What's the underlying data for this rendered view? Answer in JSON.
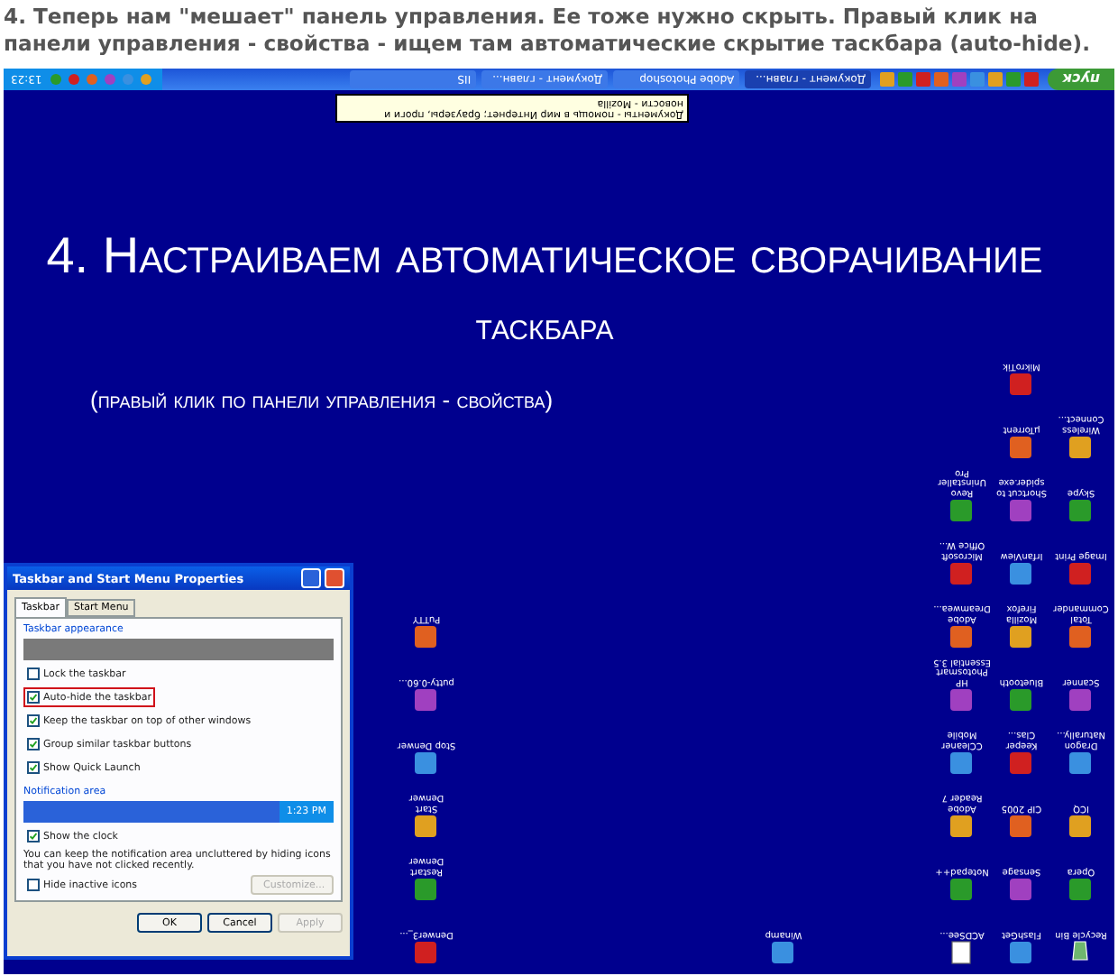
{
  "post_text": "4. Теперь нам \"мешает\" панель управления. Ее тоже нужно скрыть. Правый клик на панели управления - свойства - ищем там автоматические скрытие таскбара (auto-hide).",
  "screenshot": {
    "slide_title": [
      "4. Настраиваем автоматическое сворачивание",
      "таскбара"
    ],
    "slide_subtitle": "(правый клик по панели управления - свойства)",
    "taskbar": {
      "start": "пуск",
      "tasks": [
        {
          "label": "Документ - главн...",
          "selected": true
        },
        {
          "label": "Adobe Photoshop",
          "selected": false
        },
        {
          "label": "Документ - главн...",
          "selected": false
        },
        {
          "label": "IIS",
          "selected": false
        }
      ],
      "clock": "13:23"
    },
    "tooltip": "Документы - помощь в мир Интернет; браузеры, проги и новости - Mozilla",
    "desktop_columns": [
      {
        "icons": [
          {
            "label": "Recycle Bin",
            "kind": "bin"
          },
          {
            "label": "Opera",
            "kind": "app"
          },
          {
            "label": "ICQ",
            "kind": "app"
          },
          {
            "label": "Dragon Naturally...",
            "kind": "app"
          },
          {
            "label": "Scanner",
            "kind": "app"
          },
          {
            "label": "Total Commander",
            "kind": "app"
          },
          {
            "label": "Image Print",
            "kind": "app"
          },
          {
            "label": "Skype",
            "kind": "app"
          },
          {
            "label": "Wireless Connect...",
            "kind": "app"
          }
        ]
      },
      {
        "icons": [
          {
            "label": "FlashGet",
            "kind": "app"
          },
          {
            "label": "Sensage",
            "kind": "app"
          },
          {
            "label": "CIP 2005",
            "kind": "app"
          },
          {
            "label": "Keeper Clas...",
            "kind": "app"
          },
          {
            "label": "Bluetooth",
            "kind": "app"
          },
          {
            "label": "Mozilla Firefox",
            "kind": "app"
          },
          {
            "label": "IrfanView",
            "kind": "app"
          },
          {
            "label": "Shortcut to spider.exe",
            "kind": "app"
          },
          {
            "label": "µTorrent",
            "kind": "app"
          },
          {
            "label": "MikroTik",
            "kind": "app"
          }
        ]
      },
      {
        "icons": [
          {
            "label": "ACDSee...",
            "kind": "doc"
          },
          {
            "label": "Notepad++",
            "kind": "app"
          },
          {
            "label": "Adobe Reader 7",
            "kind": "app"
          },
          {
            "label": "CCleaner Mobile",
            "kind": "app"
          },
          {
            "label": "HP Photosmart Essential 3.5",
            "kind": "app"
          },
          {
            "label": "Adobe Dreamwea...",
            "kind": "app"
          },
          {
            "label": "Microsoft Office W...",
            "kind": "app"
          },
          {
            "label": "Revo Uninstaller Pro",
            "kind": "app"
          }
        ]
      },
      {
        "icons": [
          {
            "label": "Winamp",
            "kind": "app"
          }
        ]
      },
      {
        "icons": [
          {
            "label": "Denwer3_...",
            "kind": "app"
          },
          {
            "label": "Restart Denwer",
            "kind": "app"
          },
          {
            "label": "Start Denwer",
            "kind": "app"
          },
          {
            "label": "Stop Denwer",
            "kind": "app"
          },
          {
            "label": "putty-0.60...",
            "kind": "app"
          },
          {
            "label": "PuTTY",
            "kind": "app"
          }
        ]
      }
    ],
    "dialog": {
      "title": "Taskbar and Start Menu Properties",
      "tabs": [
        {
          "label": "Taskbar",
          "selected": true
        },
        {
          "label": "Start Menu",
          "selected": false
        }
      ],
      "appearance_group": "Taskbar appearance",
      "options": [
        {
          "label": "Lock the taskbar",
          "checked": false,
          "highlighted": false
        },
        {
          "label": "Auto-hide the taskbar",
          "checked": true,
          "highlighted": true
        },
        {
          "label": "Keep the taskbar on top of other windows",
          "checked": true,
          "highlighted": false
        },
        {
          "label": "Group similar taskbar buttons",
          "checked": true,
          "highlighted": false
        },
        {
          "label": "Show Quick Launch",
          "checked": true,
          "highlighted": false
        }
      ],
      "notification_group": "Notification area",
      "preview_clock": "1:23 PM",
      "notification_options": [
        {
          "label": "Show the clock",
          "checked": true
        }
      ],
      "note": "You can keep the notification area uncluttered by hiding icons that you have not clicked recently.",
      "hide_option": {
        "label": "Hide inactive icons",
        "checked": false
      },
      "customize": {
        "label": "Customize...",
        "disabled": true
      },
      "buttons": [
        {
          "label": "OK",
          "disabled": false
        },
        {
          "label": "Cancel",
          "disabled": false
        },
        {
          "label": "Apply",
          "disabled": true
        }
      ]
    }
  }
}
